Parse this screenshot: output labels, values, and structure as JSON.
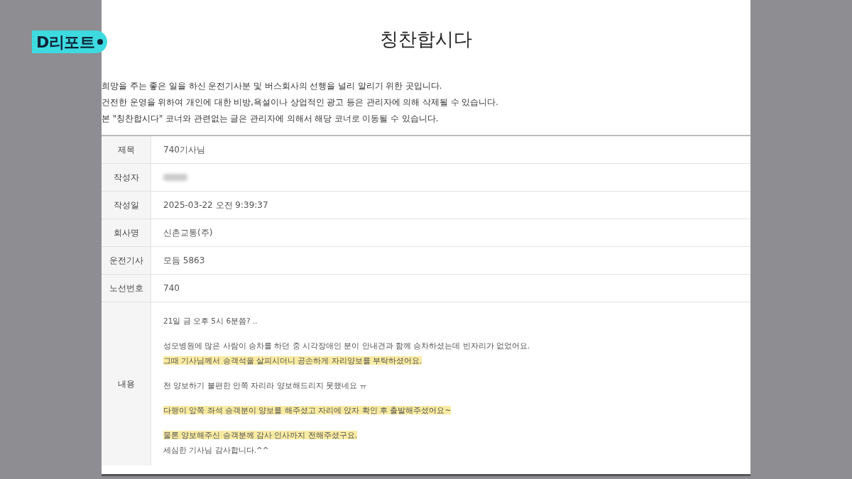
{
  "broadcast_badge": {
    "label": "D리포트"
  },
  "page": {
    "title": "칭찬합시다",
    "notice": [
      "희망을 주는 좋은 일을 하신 운전기사분 및 버스회사의 선행을 널리 알리기 위한 곳입니다.",
      "건전한 운영을 위하여 개인에 대한 비방,욕설이나 상업적인 광고 등은 관리자에 의해 삭제될 수 있습니다.",
      "본 \"칭찬합시다\" 코너와 관련없는 글은 관리자에 의해서 해당 코너로 이동될 수 있습니다."
    ],
    "fields": [
      {
        "label": "제목",
        "value": "740기사님",
        "blurred": false
      },
      {
        "label": "작성자",
        "blurred": true
      },
      {
        "label": "작성일",
        "value": "2025-03-22 오전 9:39:37",
        "blurred": false
      },
      {
        "label": "회사명",
        "value": "신촌교통(주)",
        "blurred": false
      },
      {
        "label": "운전기사",
        "value": "모듬 5863",
        "blurred": false
      },
      {
        "label": "노선번호",
        "value": "740",
        "blurred": false
      }
    ],
    "content": {
      "label": "내용",
      "paragraphs": [
        [
          {
            "text": "21일 금 오후 5시 6분쯤? ..",
            "highlighted": false
          }
        ],
        [
          {
            "text": "성모병원에 많은 사람이 승차를 하던 중 시각장애인 분이 안내견과 함께 승차하셨는데 빈자리가 없었어요.",
            "highlighted": false
          },
          {
            "text": "그때 기사님께서 승객석을 살피시더니 공손하게 자리양보를 부탁하셨어요.",
            "highlighted": true
          }
        ],
        [
          {
            "text": "전 양보하기 불편한 안쪽 자리라 양보해드리지 못했네요 ㅠ",
            "highlighted": false
          }
        ],
        [
          {
            "text": "다행이 앞쪽 좌석 승객분이 양보를 해주셨고 자리에 앉자 확인 후 출발해주셨어요~",
            "highlighted": true
          }
        ],
        [
          {
            "text": "물론 양보해주신 승객분께 감사 인사까지 전해주셨구요.",
            "highlighted": true
          },
          {
            "text": "세심한 기사님 감사합니다.^^",
            "highlighted": false
          }
        ]
      ]
    }
  }
}
